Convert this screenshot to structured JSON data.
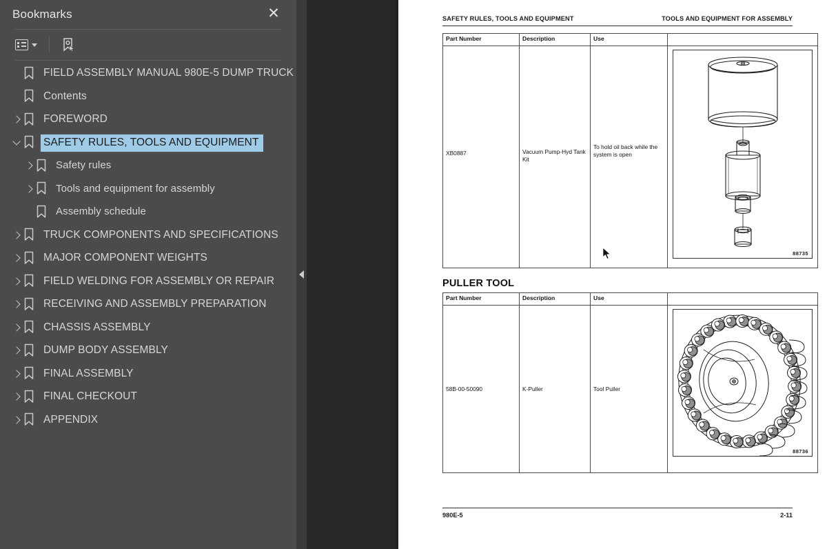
{
  "sidebar": {
    "title": "Bookmarks",
    "close_icon": "close-icon",
    "toolbar": {
      "options_icon": "list-options-icon",
      "options_caret": "chevron-down-icon",
      "select_bookmark_icon": "select-bookmark-icon"
    },
    "selection_color": "#9ecbe8",
    "items": [
      {
        "label": "FIELD ASSEMBLY MANUAL 980E-5 DUMP TRUCK",
        "level": 1,
        "twisty": "none",
        "selected": false
      },
      {
        "label": "Contents",
        "level": 1,
        "twisty": "none",
        "selected": false
      },
      {
        "label": "FOREWORD",
        "level": 1,
        "twisty": "right",
        "selected": false
      },
      {
        "label": "SAFETY RULES, TOOLS AND EQUIPMENT",
        "level": 1,
        "twisty": "down",
        "selected": true
      },
      {
        "label": "Safety rules",
        "level": 2,
        "twisty": "right",
        "selected": false
      },
      {
        "label": "Tools and equipment for assembly",
        "level": 2,
        "twisty": "right",
        "selected": false
      },
      {
        "label": "Assembly schedule",
        "level": 2,
        "twisty": "none",
        "selected": false
      },
      {
        "label": "TRUCK COMPONENTS AND SPECIFICATIONS",
        "level": 1,
        "twisty": "right",
        "selected": false
      },
      {
        "label": "MAJOR COMPONENT WEIGHTS",
        "level": 1,
        "twisty": "right",
        "selected": false
      },
      {
        "label": "FIELD WELDING FOR ASSEMBLY OR REPAIR",
        "level": 1,
        "twisty": "right",
        "selected": false
      },
      {
        "label": "RECEIVING AND ASSEMBLY PREPARATION",
        "level": 1,
        "twisty": "right",
        "selected": false
      },
      {
        "label": "CHASSIS ASSEMBLY",
        "level": 1,
        "twisty": "right",
        "selected": false
      },
      {
        "label": "DUMP BODY ASSEMBLY",
        "level": 1,
        "twisty": "right",
        "selected": false
      },
      {
        "label": "FINAL ASSEMBLY",
        "level": 1,
        "twisty": "right",
        "selected": false
      },
      {
        "label": "FINAL CHECKOUT",
        "level": 1,
        "twisty": "right",
        "selected": false
      },
      {
        "label": "APPENDIX",
        "level": 1,
        "twisty": "right",
        "selected": false
      }
    ]
  },
  "splitter": {
    "collapse_icon": "triangle-left-icon"
  },
  "document": {
    "header": {
      "left": "SAFETY RULES, TOOLS AND EQUIPMENT",
      "right": "TOOLS AND EQUIPMENT FOR ASSEMBLY"
    },
    "tables": [
      {
        "columns": [
          "Part Number",
          "Description",
          "Use",
          ""
        ],
        "rows": [
          {
            "part_number": "XB0887",
            "description": "Vacuum Pump-Hyd Tank Kit",
            "use": "To hold oil back while the system is open",
            "figure_number": "88735",
            "figure_alt": "vacuum-pump-hydraulic-tank-kit-drawing"
          }
        ]
      },
      {
        "columns": [
          "Part Number",
          "Description",
          "Use",
          ""
        ],
        "rows": [
          {
            "part_number": "58B-00-50090",
            "description": "K-Puller",
            "use": "Tool Puller",
            "figure_number": "88736",
            "figure_alt": "k-puller-tool-drawing"
          }
        ]
      }
    ],
    "section_title": "PULLER TOOL",
    "footer": {
      "left": "980E-5",
      "right": "2-11"
    }
  },
  "cursor": {
    "icon": "mouse-pointer-icon"
  }
}
